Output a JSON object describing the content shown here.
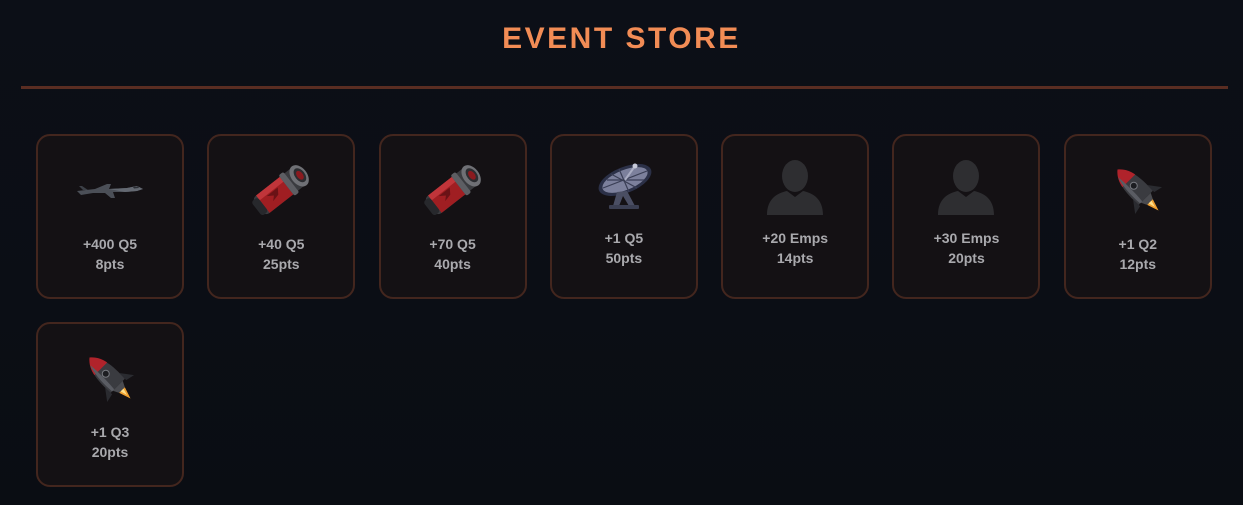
{
  "store": {
    "title": "EVENT STORE"
  },
  "items": [
    {
      "amount": "+400 Q5",
      "cost": "8pts",
      "icon": "fighter-jet-icon"
    },
    {
      "amount": "+40 Q5",
      "cost": "25pts",
      "icon": "missile-canister-icon"
    },
    {
      "amount": "+70 Q5",
      "cost": "40pts",
      "icon": "missile-canister-icon"
    },
    {
      "amount": "+1 Q5",
      "cost": "50pts",
      "icon": "satellite-dish-icon"
    },
    {
      "amount": "+20 Emps",
      "cost": "14pts",
      "icon": "person-silhouette-icon"
    },
    {
      "amount": "+30 Emps",
      "cost": "20pts",
      "icon": "person-silhouette-icon"
    },
    {
      "amount": "+1 Q2",
      "cost": "12pts",
      "icon": "rocket-icon"
    },
    {
      "amount": "+1 Q3",
      "cost": "20pts",
      "icon": "rocket-icon"
    }
  ],
  "colors": {
    "title": "#f28c55",
    "divider": "#5a2d22",
    "card_border": "#43261e",
    "card_bg": "#141114",
    "text": "#a9a9ad"
  }
}
